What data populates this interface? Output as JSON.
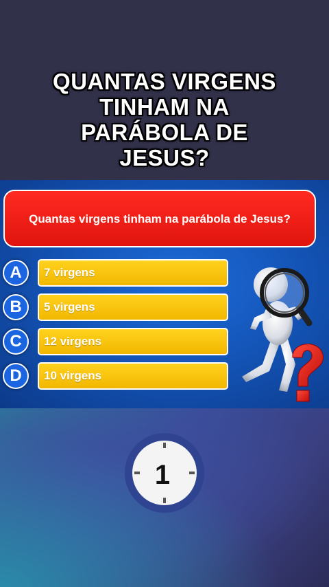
{
  "headline": {
    "lines": [
      "QUANTAS VIRGENS",
      "TINHAM NA",
      "PARÁBOLA DE",
      "JESUS?"
    ]
  },
  "quiz": {
    "question": "Quantas virgens tinham na parábola de Jesus?",
    "options": [
      {
        "letter": "A",
        "text": "7 virgens"
      },
      {
        "letter": "B",
        "text": "5 virgens"
      },
      {
        "letter": "C",
        "text": "12 virgens"
      },
      {
        "letter": "D",
        "text": "10 virgens"
      }
    ]
  },
  "timer": {
    "icon": "stopwatch-icon",
    "value": "1"
  },
  "illustration": {
    "icon": "magnifier-figure-with-question-mark"
  },
  "colors": {
    "question_bg": "#e81a14",
    "answer_bg": "#f5c000",
    "letter_bg": "#1b66e0",
    "panel_bg": "#1455b8"
  }
}
